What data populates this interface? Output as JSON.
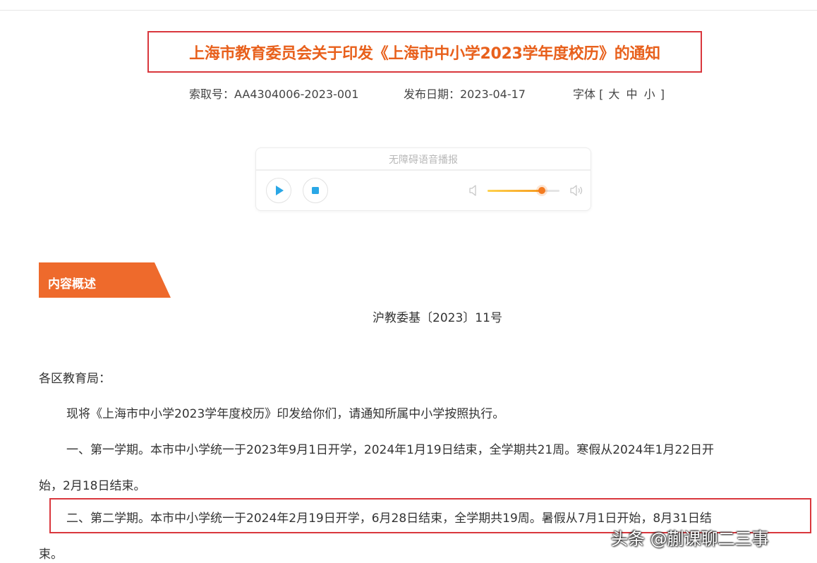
{
  "article": {
    "title": "上海市教育委员会关于印发《上海市中小学2023学年度校历》的通知",
    "index_label": "索取号：AA4304006-2023-001",
    "date_label": "发布日期：2023-04-17",
    "font_size": {
      "prefix": "字体 [ ",
      "large": "大",
      "medium": "中",
      "small": "小",
      "suffix": " ]"
    }
  },
  "player": {
    "title": "无障碍语音播报",
    "volume_level": 0.75,
    "accent_color": "#f47b20",
    "icons": [
      "play-icon",
      "stop-icon",
      "volume-low-icon",
      "volume-high-icon"
    ]
  },
  "section": {
    "tab_label": "内容概述",
    "tab_color": "#ee6a2c"
  },
  "content": {
    "doc_number": "沪教委基〔2023〕11号",
    "addressee": "各区教育局：",
    "intro": "现将《上海市中小学2023学年度校历》印发给你们，请通知所属中小学按照执行。",
    "para1_line1": "一、第一学期。本市中小学统一于2023年9月1日开学，2024年1月19日结束，全学期共21周。寒假从2024年1月22日开",
    "para1_line2": "始，2月18日结束。",
    "para2_line1": "二、第二学期。本市中小学统一于2024年2月19日开学，6月28日结束，全学期共19周。暑假从7月1日开始，8月31日结",
    "para2_line2": "束。"
  },
  "watermark": "头条 @蒯课聊二三事",
  "colors": {
    "title": "#e8601c",
    "highlight_border": "#d9373d",
    "play_icon": "#2aa7e6"
  }
}
